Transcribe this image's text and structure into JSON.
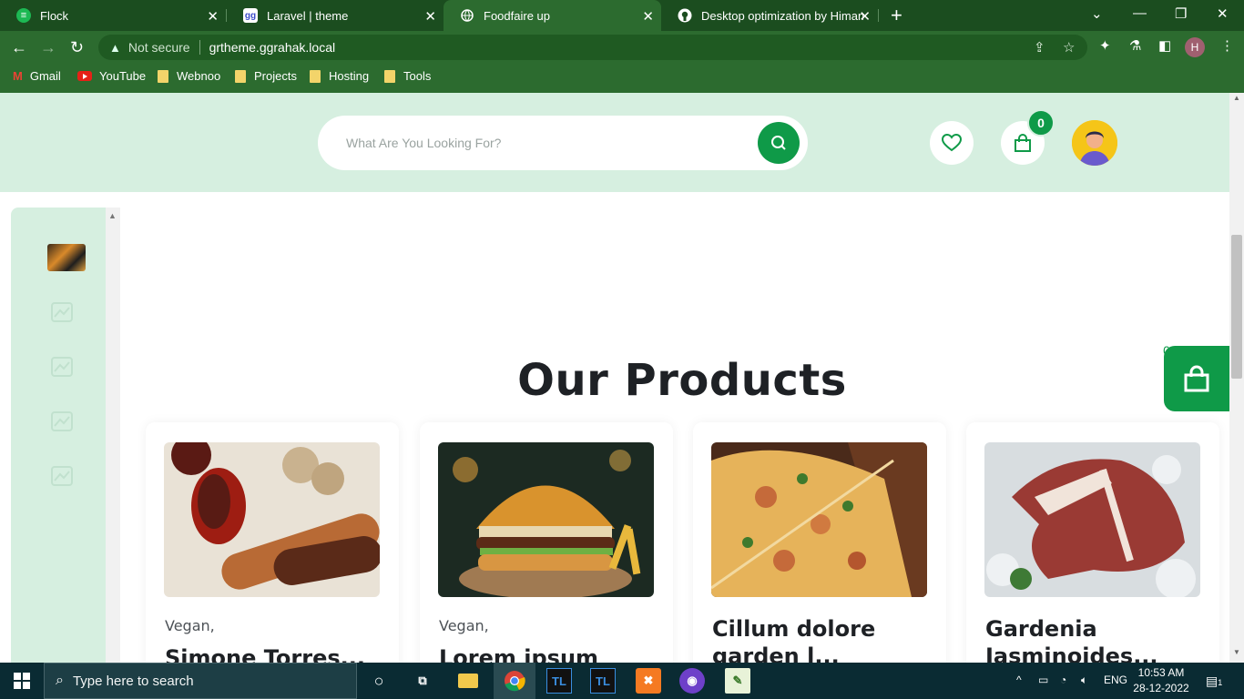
{
  "browser": {
    "tabs": [
      {
        "title": "Flock",
        "icon": "flock-icon",
        "active": false
      },
      {
        "title": "Laravel | theme",
        "icon": "laravel-icon",
        "active": false
      },
      {
        "title": "Foodfaire up",
        "icon": "globe-icon",
        "active": true
      },
      {
        "title": "Desktop optimization by Himansh",
        "icon": "github-icon",
        "active": false
      }
    ],
    "security_label": "Not secure",
    "url": "grtheme.ggrahak.local",
    "profile_initial": "H",
    "bookmarks": [
      "Gmail",
      "YouTube",
      "Webnoo",
      "Projects",
      "Hosting",
      "Tools"
    ]
  },
  "header": {
    "search_placeholder": "What Are You Looking For?",
    "cart_count": "0"
  },
  "floating_cart": {
    "count": "0"
  },
  "main": {
    "section_title": "Our Products",
    "products": [
      {
        "category": "Vegan,",
        "title": "Simone Torres..."
      },
      {
        "category": "Vegan,",
        "title": "Lorem ipsum"
      },
      {
        "category": "",
        "title": "Cillum dolore garden l..."
      },
      {
        "category": "",
        "title": "Gardenia Jasminoides..."
      }
    ]
  },
  "taskbar": {
    "search_label": "Type here to search",
    "language": "ENG",
    "time": "10:53 AM",
    "date": "28-12-2022",
    "notification_count": "1"
  },
  "colors": {
    "brand": "#0f9a48",
    "header_bg": "#d6efe0",
    "browser_frame": "#2c6b2f"
  }
}
